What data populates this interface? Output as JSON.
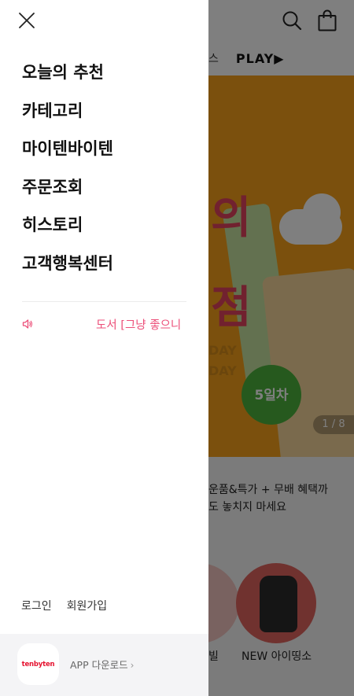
{
  "drawer": {
    "close_icon": "close-icon",
    "menu": [
      {
        "label": "오늘의 추천"
      },
      {
        "label": "카테고리"
      },
      {
        "label": "마이텐바이텐"
      },
      {
        "label": "주문조회"
      },
      {
        "label": "히스토리"
      },
      {
        "label": "고객행복센터"
      }
    ],
    "notice": {
      "icon": "speaker-icon",
      "text": "도서 [그냥 좋으니"
    },
    "auth": {
      "login": "로그인",
      "signup": "회원가입"
    },
    "app": {
      "logo_text": "tenbyten",
      "download_label": "APP 다운로드",
      "chevron": "›"
    }
  },
  "background": {
    "header_icons": [
      "search-icon",
      "shopping-bag-icon"
    ],
    "nav": [
      {
        "label": "스"
      },
      {
        "label": "PLAY▶"
      }
    ],
    "banner": {
      "text_line1": "의",
      "text_line2": "점",
      "badge": "5일차",
      "day_text1": "DAY",
      "day_text2": "DAY",
      "counter": "1 / 8"
    },
    "promo_lines": [
      "운품&특가 + 무배 혜택까",
      "도 놓치지 마세요"
    ],
    "tiles": [
      {
        "label": "빌"
      },
      {
        "label": "NEW 아이띵소"
      }
    ]
  },
  "colors": {
    "accent_pink": "#ec4f79",
    "banner_orange": "#f7a11a",
    "logo_red": "#e5122f",
    "overlay": "rgba(0,0,0,0.5)"
  }
}
